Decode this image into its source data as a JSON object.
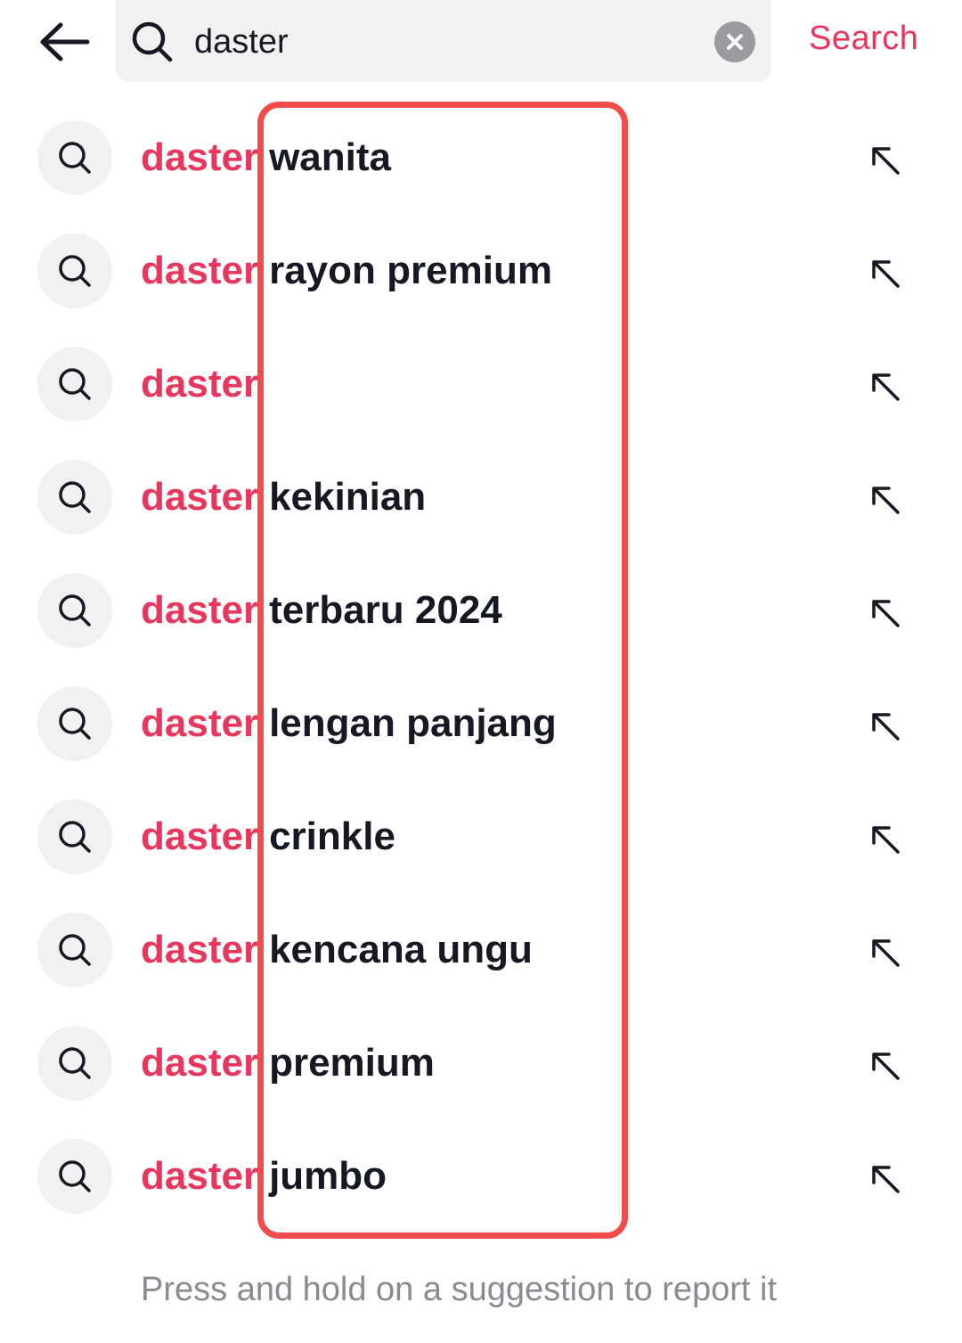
{
  "header": {
    "search_value": "daster",
    "search_action_label": "Search"
  },
  "suggestions": [
    {
      "query": "daster",
      "completion": "wanita"
    },
    {
      "query": "daster",
      "completion": "rayon premium"
    },
    {
      "query": "daster",
      "completion": ""
    },
    {
      "query": "daster",
      "completion": "kekinian"
    },
    {
      "query": "daster",
      "completion": "terbaru 2024"
    },
    {
      "query": "daster",
      "completion": "lengan panjang"
    },
    {
      "query": "daster",
      "completion": "crinkle"
    },
    {
      "query": "daster",
      "completion": "kencana ungu"
    },
    {
      "query": "daster",
      "completion": "premium"
    },
    {
      "query": "daster",
      "completion": "jumbo"
    }
  ],
  "footer_hint": "Press and hold on a suggestion to report it",
  "colors": {
    "accent": "#e8365c",
    "highlight_border": "#f04c4c",
    "text": "#161823",
    "muted": "#8a8b91",
    "chip_bg": "#f1f1f2"
  },
  "icons": {
    "back": "arrow-left-icon",
    "search": "search-icon",
    "clear": "clear-icon",
    "fill": "arrow-up-left-icon"
  }
}
